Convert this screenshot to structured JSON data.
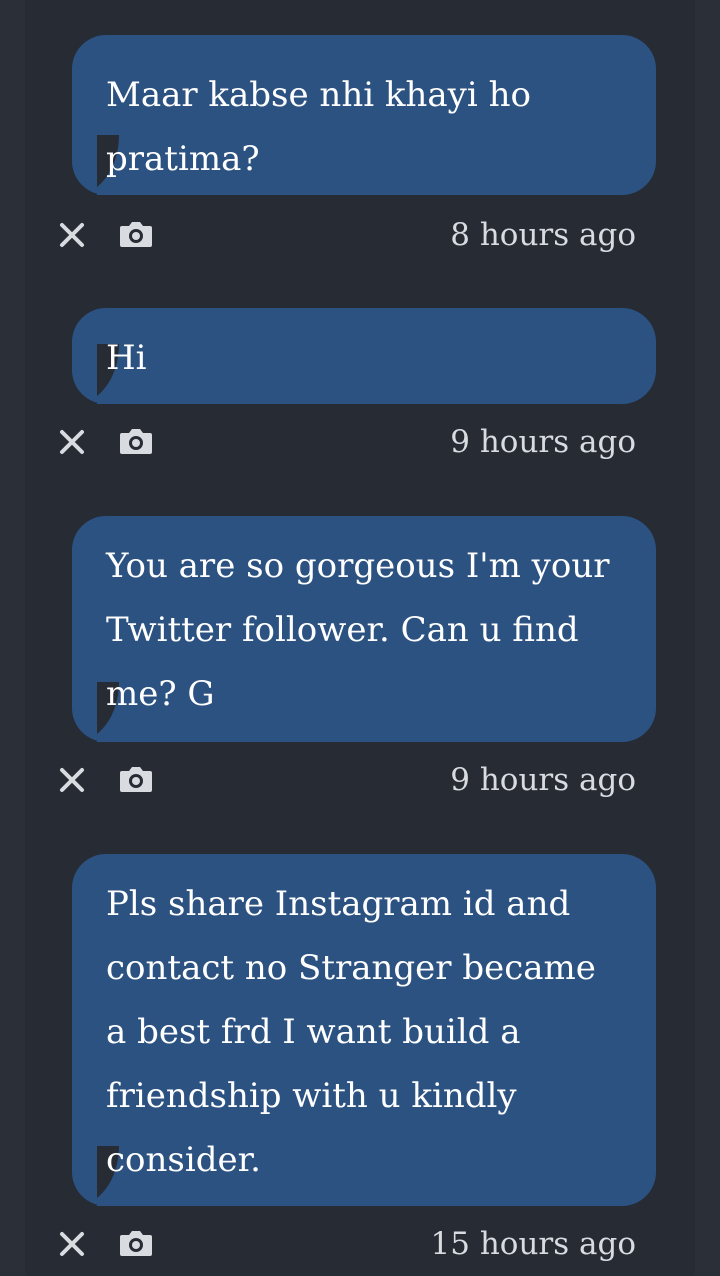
{
  "messages": [
    {
      "text": "Maar kabse nhi khayi ho pratima?",
      "time": "8 hours ago",
      "delete_icon": "close-icon",
      "screenshot_icon": "camera-icon"
    },
    {
      "text": "Hi",
      "time": "9 hours ago",
      "delete_icon": "close-icon",
      "screenshot_icon": "camera-icon"
    },
    {
      "text": "You are so gorgeous I'm your Twitter follower. Can u find me? G",
      "time": "9 hours ago",
      "delete_icon": "close-icon",
      "screenshot_icon": "camera-icon"
    },
    {
      "text": "Pls share Instagram id and contact no Stranger became a best frd I want build a friendship with u kindly consider.",
      "time": "15 hours ago",
      "delete_icon": "close-icon",
      "screenshot_icon": "camera-icon"
    }
  ],
  "colors": {
    "page_background": "#2a2f38",
    "column_background": "#262b34",
    "bubble_background": "#2c5282",
    "bubble_text": "#ffffff",
    "meta_text": "#d8dbe0"
  }
}
